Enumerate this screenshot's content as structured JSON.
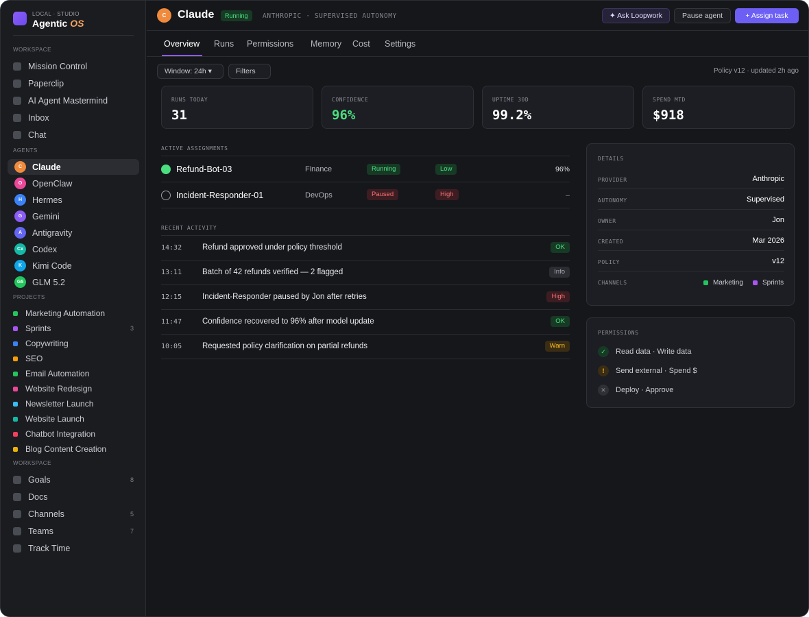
{
  "brand": {
    "subtitle": "LOCAL · STUDIO",
    "title": "Agentic",
    "title_accent": "OS"
  },
  "sidebar": {
    "workspace_label": "WORKSPACE",
    "workspace_items": [
      "Mission Control",
      "Paperclip",
      "AI Agent Mastermind",
      "Inbox",
      "Chat"
    ],
    "agents_label": "AGENTS",
    "agents": [
      {
        "initials": "C",
        "name": "Claude",
        "color": "#f08a3c"
      },
      {
        "initials": "O",
        "name": "OpenClaw",
        "color": "#ec4899"
      },
      {
        "initials": "H",
        "name": "Hermes",
        "color": "#3b82f6"
      },
      {
        "initials": "G",
        "name": "Gemini",
        "color": "#8b5cf6"
      },
      {
        "initials": "A",
        "name": "Antigravity",
        "color": "#6366f1"
      },
      {
        "initials": "Cx",
        "name": "Codex",
        "color": "#14b8a6"
      },
      {
        "initials": "K",
        "name": "Kimi Code",
        "color": "#0ea5e9"
      },
      {
        "initials": "G5",
        "name": "GLM 5.2",
        "color": "#22c55e"
      }
    ],
    "projects_label": "PROJECTS",
    "projects": [
      {
        "name": "Marketing Automation",
        "color": "#22c55e",
        "count": ""
      },
      {
        "name": "Sprints",
        "color": "#a855f7",
        "count": "3"
      },
      {
        "name": "Copywriting",
        "color": "#3b82f6",
        "count": ""
      },
      {
        "name": "SEO",
        "color": "#f59e0b",
        "count": ""
      },
      {
        "name": "Email Automation",
        "color": "#22c55e",
        "count": ""
      },
      {
        "name": "Website Redesign",
        "color": "#ec4899",
        "count": ""
      },
      {
        "name": "Newsletter Launch",
        "color": "#38bdf8",
        "count": ""
      },
      {
        "name": "Website Launch",
        "color": "#14b8a6",
        "count": ""
      },
      {
        "name": "Chatbot Integration",
        "color": "#f43f5e",
        "count": ""
      },
      {
        "name": "Blog Content Creation",
        "color": "#eab308",
        "count": ""
      }
    ],
    "workspace2_label": "WORKSPACE",
    "workspace2_items": [
      {
        "name": "Goals",
        "count": "8"
      },
      {
        "name": "Docs",
        "count": ""
      },
      {
        "name": "Channels",
        "count": "5"
      },
      {
        "name": "Teams",
        "count": "7"
      },
      {
        "name": "Track Time",
        "count": ""
      }
    ]
  },
  "header": {
    "avatar": "C",
    "title": "Claude",
    "status": "Running",
    "meta": "ANTHROPIC · SUPERVISED AUTONOMY",
    "ask_button": "✦ Ask Loopwork",
    "pause_button": "Pause agent",
    "assign_button": "+ Assign task"
  },
  "tabs": [
    "Overview",
    "Runs",
    "Permissions",
    "Memory",
    "Cost",
    "Settings"
  ],
  "filters": {
    "window": "Window: 24h ▾",
    "filters": "Filters",
    "policy_note": "Policy v12 · updated 2h ago"
  },
  "stats": [
    {
      "label": "RUNS TODAY",
      "value": "31",
      "color": "#ffffff"
    },
    {
      "label": "CONFIDENCE",
      "value": "96%",
      "color": "#4ade80"
    },
    {
      "label": "UPTIME 30D",
      "value": "99.2%",
      "color": "#ffffff"
    },
    {
      "label": "SPEND MTD",
      "value": "$918",
      "color": "#ffffff"
    }
  ],
  "assignments": {
    "label": "ACTIVE ASSIGNMENTS",
    "rows": [
      {
        "name": "Refund-Bot-03",
        "team": "Finance",
        "status": "Running",
        "risk": "Low",
        "pct": "96%",
        "active": true
      },
      {
        "name": "Incident-Responder-01",
        "team": "DevOps",
        "status": "Paused",
        "risk": "High",
        "pct": "–",
        "active": false
      }
    ]
  },
  "activity": {
    "label": "RECENT ACTIVITY",
    "rows": [
      {
        "time": "14:32",
        "text": "Refund approved under policy threshold",
        "badge": "OK",
        "kind": "green"
      },
      {
        "time": "13:11",
        "text": "Batch of 42 refunds verified — 2 flagged",
        "badge": "Info",
        "kind": "grey"
      },
      {
        "time": "12:15",
        "text": "Incident-Responder paused by Jon after retries",
        "badge": "High",
        "kind": "red"
      },
      {
        "time": "11:47",
        "text": "Confidence recovered to 96% after model update",
        "badge": "OK",
        "kind": "green"
      },
      {
        "time": "10:05",
        "text": "Requested policy clarification on partial refunds",
        "badge": "Warn",
        "kind": "amber"
      }
    ]
  },
  "details": {
    "label": "DETAILS",
    "rows": [
      {
        "key": "PROVIDER",
        "value": "Anthropic"
      },
      {
        "key": "AUTONOMY",
        "value": "Supervised"
      },
      {
        "key": "OWNER",
        "value": "Jon"
      },
      {
        "key": "CREATED",
        "value": "Mar 2026"
      },
      {
        "key": "POLICY",
        "value": "v12"
      }
    ],
    "channels_key": "CHANNELS",
    "channels": [
      {
        "name": "Marketing",
        "color": "#22c55e"
      },
      {
        "name": "Sprints",
        "color": "#a855f7"
      }
    ]
  },
  "permissions": {
    "label": "PERMISSIONS",
    "rows": [
      {
        "icon": "✓",
        "kind": "ok",
        "text": "Read data · Write data"
      },
      {
        "icon": "!",
        "kind": "warn",
        "text": "Send external · Spend $"
      },
      {
        "icon": "✕",
        "kind": "no",
        "text": "Deploy · Approve"
      }
    ]
  }
}
